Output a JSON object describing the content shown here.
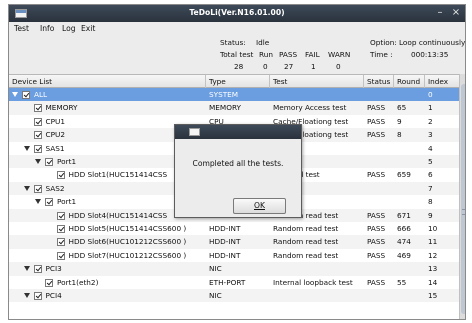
{
  "window": {
    "title": "TeDoLi(Ver.N16.01.00)",
    "minimize_glyph": "–",
    "close_glyph": "×"
  },
  "menu": [
    "Test",
    "Info",
    "Log",
    "Exit"
  ],
  "status": {
    "status_label": "Status:",
    "status_value": "Idle",
    "total_test_label": "Total test",
    "run_label": "Run",
    "pass_label": "PASS",
    "fail_label": "FAIL",
    "warn_label": "WARN",
    "total_test": "28",
    "run": "0",
    "pass": "27",
    "fail": "1",
    "warn": "0",
    "option_label": "Option:",
    "option_value": "Loop continuously",
    "time_label": "Time :",
    "time_value": "000:13:35"
  },
  "columns": [
    "Device List",
    "Type",
    "Test",
    "Status",
    "Round",
    "Index"
  ],
  "rows": [
    {
      "device": "ALL",
      "type": "SYSTEM",
      "test": "",
      "status": "",
      "round": "",
      "index": "0"
    },
    {
      "device": "MEMORY",
      "type": "MEMORY",
      "test": "Memory Access test",
      "status": "PASS",
      "round": "65",
      "index": "1"
    },
    {
      "device": "CPU1",
      "type": "CPU",
      "test": "Cache/Floationg test",
      "status": "PASS",
      "round": "9",
      "index": "2"
    },
    {
      "device": "CPU2",
      "type": "CPU",
      "test": "Cache/Floationg test",
      "status": "PASS",
      "round": "8",
      "index": "3"
    },
    {
      "device": "SAS1",
      "type": "",
      "test": "",
      "status": "",
      "round": "",
      "index": "4"
    },
    {
      "device": "Port1",
      "type": "",
      "test": "",
      "status": "",
      "round": "",
      "index": "5"
    },
    {
      "device": "HDD Slot1(HUC151414CSS",
      "type": "",
      "test": "om read test",
      "status": "PASS",
      "round": "659",
      "index": "6"
    },
    {
      "device": "SAS2",
      "type": "",
      "test": "",
      "status": "",
      "round": "",
      "index": "7"
    },
    {
      "device": "Port1",
      "type": "",
      "test": "",
      "status": "",
      "round": "",
      "index": "8"
    },
    {
      "device": "HDD Slot4(HUC151414CSS",
      "type": "",
      "test": "Random read test",
      "status": "PASS",
      "round": "671",
      "index": "9"
    },
    {
      "device": "HDD Slot5(HUC151414CSS600 )",
      "type": "HDD-INT",
      "test": "Random read test",
      "status": "PASS",
      "round": "666",
      "index": "10"
    },
    {
      "device": "HDD Slot6(HUC101212CSS600 )",
      "type": "HDD-INT",
      "test": "Random read test",
      "status": "PASS",
      "round": "474",
      "index": "11"
    },
    {
      "device": "HDD Slot7(HUC101212CSS600 )",
      "type": "HDD-INT",
      "test": "Random read test",
      "status": "PASS",
      "round": "469",
      "index": "12"
    },
    {
      "device": "PCI3",
      "type": "NIC",
      "test": "",
      "status": "",
      "round": "",
      "index": "13"
    },
    {
      "device": "Port1(eth2)",
      "type": "ETH-PORT",
      "test": "Internal loopback test",
      "status": "PASS",
      "round": "55",
      "index": "14"
    },
    {
      "device": "PCI4",
      "type": "NIC",
      "test": "",
      "status": "",
      "round": "",
      "index": "15"
    }
  ],
  "dialog": {
    "message": "Completed all the tests.",
    "ok_label": "OK"
  },
  "colors": {
    "titlebar": "#2f3844",
    "selected_row": "#6b9ee0",
    "background": "#ececec"
  }
}
